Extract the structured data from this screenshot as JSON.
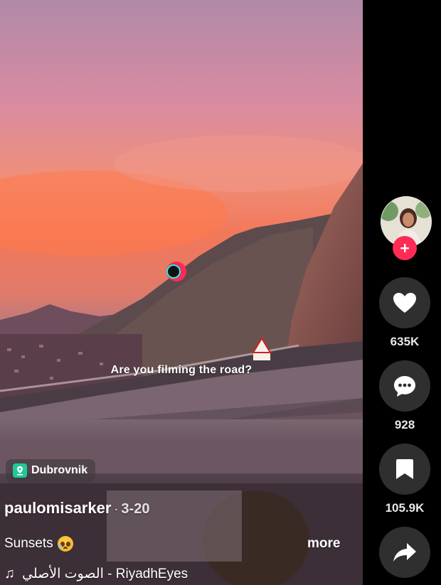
{
  "video": {
    "overlay_text": "Are you filming the road?",
    "location_chip": {
      "icon": "location-pin-icon",
      "label": "Dubrovnik"
    },
    "author": {
      "username": "paulomisarker",
      "separator": "·",
      "date": "3-20"
    },
    "description": {
      "text": "Sunsets",
      "emoji": "crying-face-emoji"
    },
    "more_label": "more",
    "music": {
      "icon": "music-note-icon",
      "track": "الصوت الأصلي - RiyadhEyes"
    }
  },
  "rail": {
    "avatar": {
      "icon": "profile-avatar",
      "follow_icon": "plus-icon"
    },
    "actions": [
      {
        "name": "like",
        "icon": "heart-icon",
        "count": "635K"
      },
      {
        "name": "comment",
        "icon": "comment-icon",
        "count": "928"
      },
      {
        "name": "save",
        "icon": "bookmark-icon",
        "count": "105.9K"
      },
      {
        "name": "share",
        "icon": "share-arrow-icon",
        "count": ""
      }
    ]
  },
  "colors": {
    "follow": "#fe2c55",
    "action_bg": "#2f2f2f",
    "location_pin": "#20c997"
  }
}
